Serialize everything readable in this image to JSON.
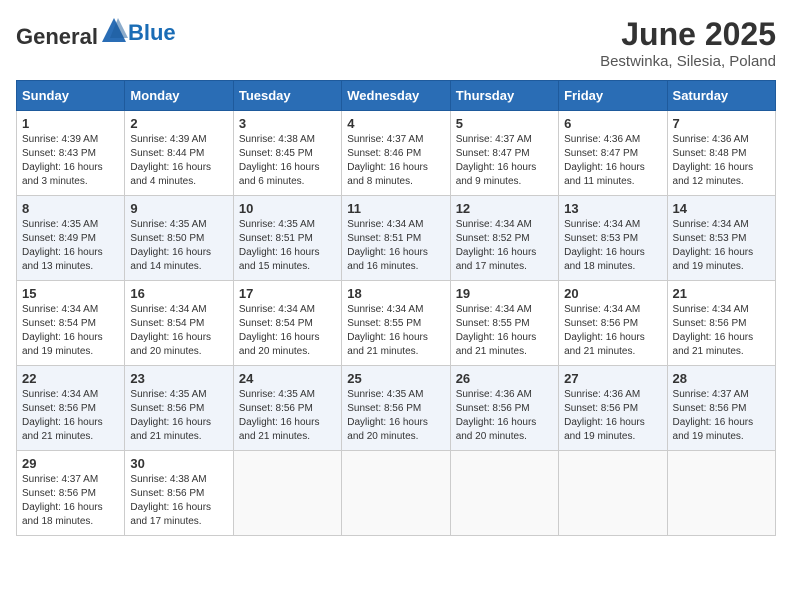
{
  "header": {
    "logo_general": "General",
    "logo_blue": "Blue",
    "title": "June 2025",
    "subtitle": "Bestwinka, Silesia, Poland"
  },
  "days_of_week": [
    "Sunday",
    "Monday",
    "Tuesday",
    "Wednesday",
    "Thursday",
    "Friday",
    "Saturday"
  ],
  "weeks": [
    [
      {
        "day": "1",
        "sunrise": "Sunrise: 4:39 AM",
        "sunset": "Sunset: 8:43 PM",
        "daylight": "Daylight: 16 hours and 3 minutes."
      },
      {
        "day": "2",
        "sunrise": "Sunrise: 4:39 AM",
        "sunset": "Sunset: 8:44 PM",
        "daylight": "Daylight: 16 hours and 4 minutes."
      },
      {
        "day": "3",
        "sunrise": "Sunrise: 4:38 AM",
        "sunset": "Sunset: 8:45 PM",
        "daylight": "Daylight: 16 hours and 6 minutes."
      },
      {
        "day": "4",
        "sunrise": "Sunrise: 4:37 AM",
        "sunset": "Sunset: 8:46 PM",
        "daylight": "Daylight: 16 hours and 8 minutes."
      },
      {
        "day": "5",
        "sunrise": "Sunrise: 4:37 AM",
        "sunset": "Sunset: 8:47 PM",
        "daylight": "Daylight: 16 hours and 9 minutes."
      },
      {
        "day": "6",
        "sunrise": "Sunrise: 4:36 AM",
        "sunset": "Sunset: 8:47 PM",
        "daylight": "Daylight: 16 hours and 11 minutes."
      },
      {
        "day": "7",
        "sunrise": "Sunrise: 4:36 AM",
        "sunset": "Sunset: 8:48 PM",
        "daylight": "Daylight: 16 hours and 12 minutes."
      }
    ],
    [
      {
        "day": "8",
        "sunrise": "Sunrise: 4:35 AM",
        "sunset": "Sunset: 8:49 PM",
        "daylight": "Daylight: 16 hours and 13 minutes."
      },
      {
        "day": "9",
        "sunrise": "Sunrise: 4:35 AM",
        "sunset": "Sunset: 8:50 PM",
        "daylight": "Daylight: 16 hours and 14 minutes."
      },
      {
        "day": "10",
        "sunrise": "Sunrise: 4:35 AM",
        "sunset": "Sunset: 8:51 PM",
        "daylight": "Daylight: 16 hours and 15 minutes."
      },
      {
        "day": "11",
        "sunrise": "Sunrise: 4:34 AM",
        "sunset": "Sunset: 8:51 PM",
        "daylight": "Daylight: 16 hours and 16 minutes."
      },
      {
        "day": "12",
        "sunrise": "Sunrise: 4:34 AM",
        "sunset": "Sunset: 8:52 PM",
        "daylight": "Daylight: 16 hours and 17 minutes."
      },
      {
        "day": "13",
        "sunrise": "Sunrise: 4:34 AM",
        "sunset": "Sunset: 8:53 PM",
        "daylight": "Daylight: 16 hours and 18 minutes."
      },
      {
        "day": "14",
        "sunrise": "Sunrise: 4:34 AM",
        "sunset": "Sunset: 8:53 PM",
        "daylight": "Daylight: 16 hours and 19 minutes."
      }
    ],
    [
      {
        "day": "15",
        "sunrise": "Sunrise: 4:34 AM",
        "sunset": "Sunset: 8:54 PM",
        "daylight": "Daylight: 16 hours and 19 minutes."
      },
      {
        "day": "16",
        "sunrise": "Sunrise: 4:34 AM",
        "sunset": "Sunset: 8:54 PM",
        "daylight": "Daylight: 16 hours and 20 minutes."
      },
      {
        "day": "17",
        "sunrise": "Sunrise: 4:34 AM",
        "sunset": "Sunset: 8:54 PM",
        "daylight": "Daylight: 16 hours and 20 minutes."
      },
      {
        "day": "18",
        "sunrise": "Sunrise: 4:34 AM",
        "sunset": "Sunset: 8:55 PM",
        "daylight": "Daylight: 16 hours and 21 minutes."
      },
      {
        "day": "19",
        "sunrise": "Sunrise: 4:34 AM",
        "sunset": "Sunset: 8:55 PM",
        "daylight": "Daylight: 16 hours and 21 minutes."
      },
      {
        "day": "20",
        "sunrise": "Sunrise: 4:34 AM",
        "sunset": "Sunset: 8:56 PM",
        "daylight": "Daylight: 16 hours and 21 minutes."
      },
      {
        "day": "21",
        "sunrise": "Sunrise: 4:34 AM",
        "sunset": "Sunset: 8:56 PM",
        "daylight": "Daylight: 16 hours and 21 minutes."
      }
    ],
    [
      {
        "day": "22",
        "sunrise": "Sunrise: 4:34 AM",
        "sunset": "Sunset: 8:56 PM",
        "daylight": "Daylight: 16 hours and 21 minutes."
      },
      {
        "day": "23",
        "sunrise": "Sunrise: 4:35 AM",
        "sunset": "Sunset: 8:56 PM",
        "daylight": "Daylight: 16 hours and 21 minutes."
      },
      {
        "day": "24",
        "sunrise": "Sunrise: 4:35 AM",
        "sunset": "Sunset: 8:56 PM",
        "daylight": "Daylight: 16 hours and 21 minutes."
      },
      {
        "day": "25",
        "sunrise": "Sunrise: 4:35 AM",
        "sunset": "Sunset: 8:56 PM",
        "daylight": "Daylight: 16 hours and 20 minutes."
      },
      {
        "day": "26",
        "sunrise": "Sunrise: 4:36 AM",
        "sunset": "Sunset: 8:56 PM",
        "daylight": "Daylight: 16 hours and 20 minutes."
      },
      {
        "day": "27",
        "sunrise": "Sunrise: 4:36 AM",
        "sunset": "Sunset: 8:56 PM",
        "daylight": "Daylight: 16 hours and 19 minutes."
      },
      {
        "day": "28",
        "sunrise": "Sunrise: 4:37 AM",
        "sunset": "Sunset: 8:56 PM",
        "daylight": "Daylight: 16 hours and 19 minutes."
      }
    ],
    [
      {
        "day": "29",
        "sunrise": "Sunrise: 4:37 AM",
        "sunset": "Sunset: 8:56 PM",
        "daylight": "Daylight: 16 hours and 18 minutes."
      },
      {
        "day": "30",
        "sunrise": "Sunrise: 4:38 AM",
        "sunset": "Sunset: 8:56 PM",
        "daylight": "Daylight: 16 hours and 17 minutes."
      },
      null,
      null,
      null,
      null,
      null
    ]
  ]
}
